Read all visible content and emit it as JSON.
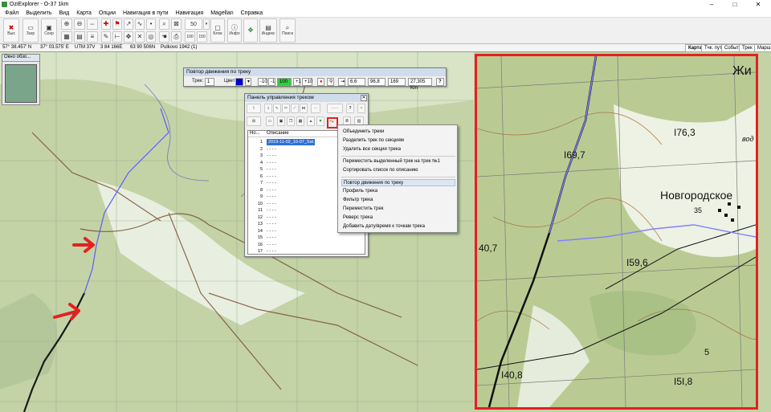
{
  "window": {
    "title": "OziExplorer - O-37 1km",
    "min": "–",
    "max": "□",
    "close": "✕"
  },
  "menu": [
    "Файл",
    "Выделить",
    "Вид",
    "Карта",
    "Опции",
    "Навигация в пути",
    "Навигация",
    "Magellan",
    "Справка"
  ],
  "toolbar": {
    "exit": "Вых",
    "load": "Загр",
    "save": "Сохр",
    "zoom_value": "50",
    "block": "Блок",
    "info": "Инфо",
    "index": "Индекс",
    "search": "Поиск",
    "zoom_100": "100",
    "zoom_150": "150"
  },
  "status": {
    "lat": "57° 38.457' N",
    "lon": "37° 03.575' E",
    "utm": "UTM  37V",
    "east": "3 84 166E",
    "north": "63 90 506N",
    "datum": "Pulkovo 1942 (1)",
    "tabs": [
      "Карта",
      "Тчк. пут",
      "Событ",
      "Трек",
      "Марш"
    ]
  },
  "overview": {
    "title": "Окно обзо..."
  },
  "replay": {
    "title": "Повтор движения по треку",
    "track_label": "Трек:",
    "track_value": "1",
    "color_label": "Цвет",
    "color": "#0000cc",
    "minus10": "-10",
    "minus1": "-1",
    "speed": "100",
    "plus1": "+1",
    "plus10": "+10",
    "v1": "6,6",
    "v2": "96,8",
    "v3": "169",
    "distance": "27,305 Km",
    "help": "?"
  },
  "trackpanel": {
    "title": "Панель управления треком",
    "col_no": "Но...",
    "col_desc": "Описание",
    "rows": [
      {
        "n": "1",
        "d": "2019-11-02_10-07_Sat",
        "sel": true
      },
      {
        "n": "2",
        "d": "- - - -"
      },
      {
        "n": "3",
        "d": "- - - -"
      },
      {
        "n": "4",
        "d": "- - - -"
      },
      {
        "n": "5",
        "d": "- - - -"
      },
      {
        "n": "6",
        "d": "- - - -"
      },
      {
        "n": "7",
        "d": "- - - -"
      },
      {
        "n": "8",
        "d": "- - - -"
      },
      {
        "n": "9",
        "d": "- - - -"
      },
      {
        "n": "10",
        "d": "- - - -"
      },
      {
        "n": "11",
        "d": "- - - -"
      },
      {
        "n": "12",
        "d": "- - - -"
      },
      {
        "n": "13",
        "d": "- - - -"
      },
      {
        "n": "14",
        "d": "- - - -"
      },
      {
        "n": "15",
        "d": "- - - -"
      },
      {
        "n": "16",
        "d": "- - - -"
      },
      {
        "n": "17",
        "d": "- - - -"
      }
    ]
  },
  "context_menu": [
    "Объединить треки",
    "Разделить трек по секциям",
    "Удалить все секции трека",
    "Переместить выделенный трек на трек №1",
    "Сортировать список по описанию",
    "Повтор движения по треку",
    "Профиль трека",
    "Фильтр трека",
    "Переместить трек",
    "Реверс трека",
    "Добавить дату/время к точкам трека"
  ],
  "map_labels": {
    "z1": "Жи",
    "z2": "I76,3",
    "z3": "I69,7",
    "z4": "Новгородское",
    "z5": "I59,6",
    "z6": "40,7",
    "z7": "I40,8",
    "z8": "I5I,8",
    "z9": "5",
    "z10": "35",
    "z11": "вод"
  },
  "colors": {
    "highlight": "#e52020",
    "track": "#1a1a1a",
    "trackblue": "#6b6bff",
    "speed_green": "#2ecc40"
  }
}
